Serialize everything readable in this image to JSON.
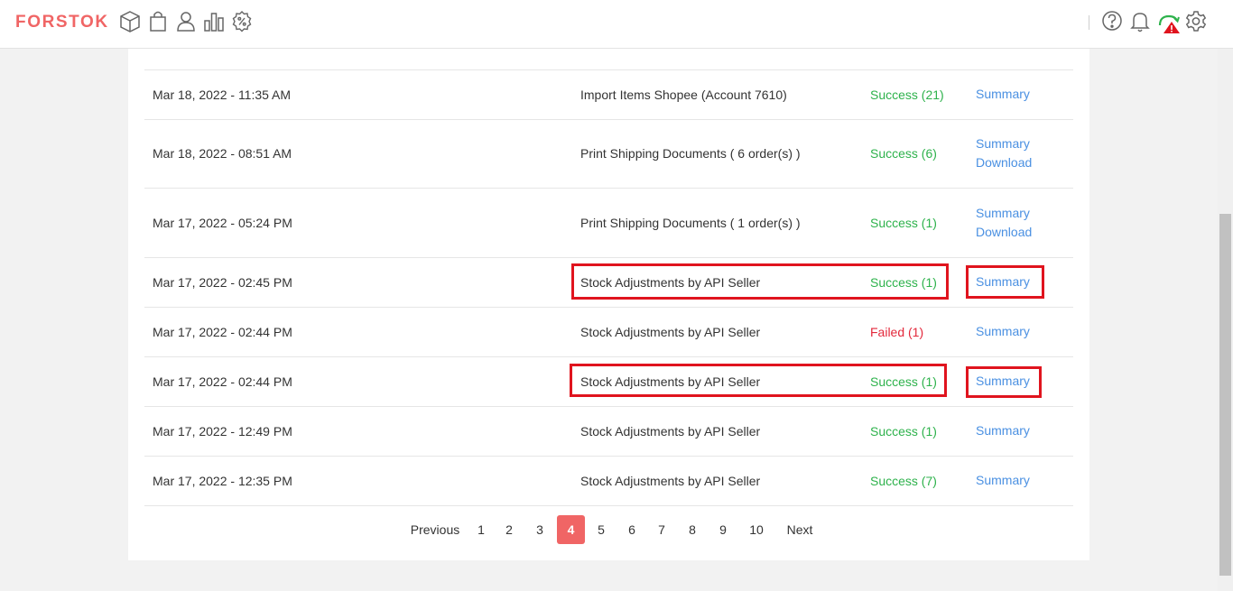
{
  "header": {
    "logo": "FORSTOK",
    "logo_color": "#f06565",
    "nav_icons": [
      "box-icon",
      "bag-icon",
      "user-icon",
      "bar-chart-icon",
      "discount-icon"
    ],
    "right_icons": [
      "help-icon",
      "bell-icon",
      "sync-alert-icon",
      "gear-icon"
    ]
  },
  "colors": {
    "success": "#2eb24c",
    "failed": "#e3283b",
    "link": "#4a90e2",
    "highlight": "#e0141e",
    "active_page": "#f06565"
  },
  "rows": [
    {
      "date": "Mar 18, 2022 - 11:35 AM",
      "desc": "Import Items Shopee (Account 7610)",
      "status": "Success (21)",
      "state": "success",
      "links": [
        "Summary"
      ]
    },
    {
      "date": "Mar 18, 2022 - 08:51 AM",
      "desc": "Print Shipping Documents ( 6 order(s) )",
      "status": "Success (6)",
      "state": "success",
      "links": [
        "Summary",
        "Download"
      ]
    },
    {
      "date": "Mar 17, 2022 - 05:24 PM",
      "desc": "Print Shipping Documents ( 1 order(s) )",
      "status": "Success (1)",
      "state": "success",
      "links": [
        "Summary",
        "Download"
      ]
    },
    {
      "date": "Mar 17, 2022 - 02:45 PM",
      "desc": "Stock Adjustments by API Seller",
      "status": "Success (1)",
      "state": "success",
      "links": [
        "Summary"
      ]
    },
    {
      "date": "Mar 17, 2022 - 02:44 PM",
      "desc": "Stock Adjustments by API Seller",
      "status": "Failed (1)",
      "state": "failed",
      "links": [
        "Summary"
      ]
    },
    {
      "date": "Mar 17, 2022 - 02:44 PM",
      "desc": "Stock Adjustments by API Seller",
      "status": "Success (1)",
      "state": "success",
      "links": [
        "Summary"
      ]
    },
    {
      "date": "Mar 17, 2022 - 12:49 PM",
      "desc": "Stock Adjustments by API Seller",
      "status": "Success (1)",
      "state": "success",
      "links": [
        "Summary"
      ]
    },
    {
      "date": "Mar 17, 2022 - 12:35 PM",
      "desc": "Stock Adjustments by API Seller",
      "status": "Success (7)",
      "state": "success",
      "links": [
        "Summary"
      ]
    }
  ],
  "pagination": {
    "previous": "Previous",
    "pages": [
      "1",
      "2",
      "3",
      "4",
      "5",
      "6",
      "7",
      "8",
      "9",
      "10"
    ],
    "current": "4",
    "next": "Next"
  }
}
